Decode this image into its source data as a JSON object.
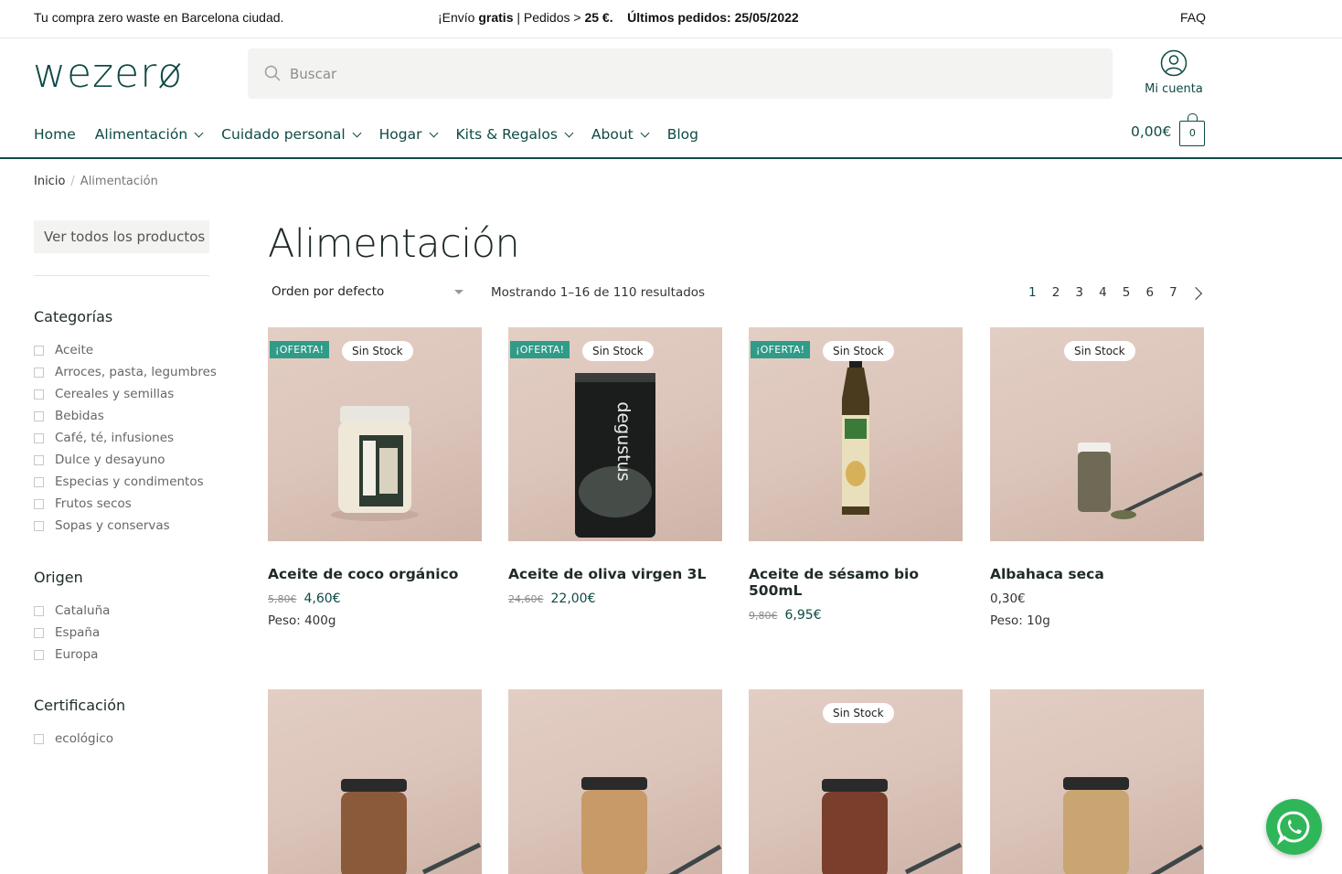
{
  "topbar": {
    "left": "Tu compra zero waste en Barcelona ciudad.",
    "shipping_prefix": "¡Envío ",
    "shipping_bold": "gratis",
    "shipping_mid": " | Pedidos > ",
    "shipping_amount": "25 €.",
    "last_orders": "Últimos pedidos: 25/05/2022",
    "faq": "FAQ"
  },
  "header": {
    "logo": "wezerø",
    "search_placeholder": "Buscar",
    "account_label": "Mi cuenta"
  },
  "nav": {
    "items": [
      {
        "label": "Home",
        "dropdown": false
      },
      {
        "label": "Alimentación",
        "dropdown": true
      },
      {
        "label": "Cuidado personal",
        "dropdown": true
      },
      {
        "label": "Hogar",
        "dropdown": true
      },
      {
        "label": "Kits & Regalos",
        "dropdown": true
      },
      {
        "label": "About",
        "dropdown": true
      },
      {
        "label": "Blog",
        "dropdown": false
      }
    ],
    "cart_total": "0,00€",
    "cart_count": "0"
  },
  "breadcrumb": {
    "home": "Inicio",
    "separator": "/",
    "current": "Alimentación"
  },
  "sidebar": {
    "all_products": "Ver todos los productos",
    "categories_title": "Categorías",
    "categories": [
      "Aceite",
      "Arroces, pasta, legumbres",
      "Cereales y semillas",
      "Bebidas",
      "Café, té, infusiones",
      "Dulce y desayuno",
      "Especias y condimentos",
      "Frutos secos",
      "Sopas y conservas"
    ],
    "origin_title": "Origen",
    "origins": [
      "Cataluña",
      "España",
      "Europa"
    ],
    "cert_title": "Certificación",
    "certs": [
      "ecológico"
    ]
  },
  "main": {
    "title": "Alimentación",
    "orderby": "Orden por defecto",
    "results": "Mostrando 1–16 de 110 resultados",
    "pages": [
      "1",
      "2",
      "3",
      "4",
      "5",
      "6",
      "7"
    ],
    "current_page": "1"
  },
  "products": [
    {
      "name": "Aceite de coco orgánico",
      "oferta": "¡OFERTA!",
      "stock": "Sin Stock",
      "old_price": "5,80€",
      "price": "4,60€",
      "weight": "Peso: 400g",
      "image": "coconut-oil-jar"
    },
    {
      "name": "Aceite de oliva virgen 3L",
      "oferta": "¡OFERTA!",
      "stock": "Sin Stock",
      "old_price": "24,60€",
      "price": "22,00€",
      "weight": "",
      "image": "olive-oil-tin",
      "tin_brand": "degustus"
    },
    {
      "name": "Aceite de sésamo bio 500mL",
      "oferta": "¡OFERTA!",
      "stock": "Sin Stock",
      "old_price": "9,80€",
      "price": "6,95€",
      "weight": "",
      "image": "sesame-oil-bottle"
    },
    {
      "name": "Albahaca seca",
      "oferta": "",
      "stock": "Sin Stock",
      "old_price": "",
      "price": "0,30€",
      "weight": "Peso: 10g",
      "image": "basil-jar"
    },
    {
      "name": "",
      "oferta": "",
      "stock": "",
      "image": "nuts-jar"
    },
    {
      "name": "",
      "oferta": "",
      "stock": "",
      "image": "nuts-jar"
    },
    {
      "name": "",
      "oferta": "",
      "stock": "Sin Stock",
      "image": "nuts-jar"
    },
    {
      "name": "",
      "oferta": "",
      "stock": "",
      "image": "nuts-jar"
    }
  ],
  "colors": {
    "brand": "#0e4a45",
    "oferta_badge": "#2f9b88",
    "whatsapp": "#2fb659",
    "product_bg": "#dcc5bb"
  },
  "icons": {
    "search": "search-icon",
    "account": "user-circle-icon",
    "cart": "shopping-bag-icon",
    "whatsapp": "whatsapp-icon"
  }
}
